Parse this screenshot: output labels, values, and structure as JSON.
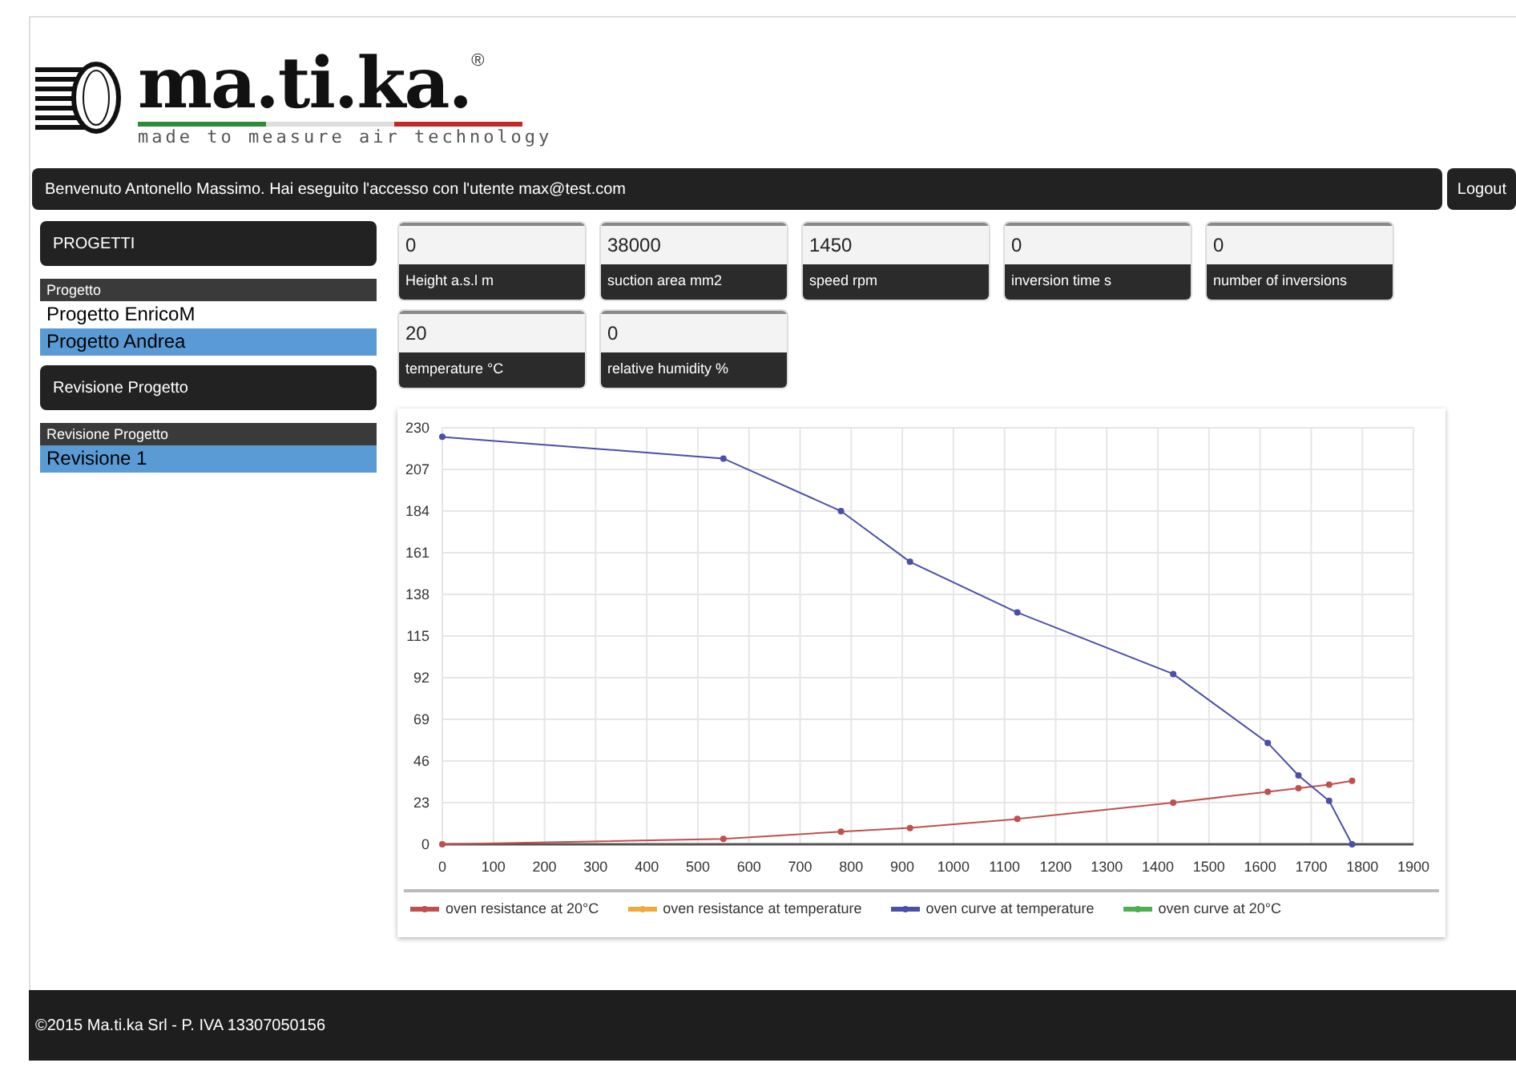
{
  "logo": {
    "name": "ma.ti.ka.",
    "registered": "®",
    "tagline": "made to measure air technology"
  },
  "welcome_bar": {
    "text": "Benvenuto Antonello Massimo. Hai eseguito l'accesso con l'utente max@test.com"
  },
  "logout_button": {
    "label": "Logout"
  },
  "sidebar": {
    "projects_header": "PROGETTI",
    "projects_list": {
      "header": "Progetto",
      "items": [
        {
          "label": "Progetto EnricoM",
          "selected": false
        },
        {
          "label": "Progetto Andrea",
          "selected": true
        }
      ]
    },
    "revision_header": "Revisione Progetto",
    "revision_list": {
      "header": "Revisione Progetto",
      "items": [
        {
          "label": "Revisione 1",
          "selected": true
        }
      ]
    }
  },
  "fields": [
    {
      "value": "0",
      "label": "Height a.s.l m"
    },
    {
      "value": "38000",
      "label": "suction area mm2"
    },
    {
      "value": "1450",
      "label": "speed rpm"
    },
    {
      "value": "0",
      "label": "inversion time s"
    },
    {
      "value": "0",
      "label": "number of inversions"
    },
    {
      "value": "20",
      "label": "temperature °C"
    },
    {
      "value": "0",
      "label": "relative humidity %"
    }
  ],
  "chart_data": {
    "type": "line",
    "x": [
      0,
      550,
      780,
      915,
      1125,
      1430,
      1615,
      1675,
      1735,
      1780
    ],
    "series": [
      {
        "name": "oven resistance at 20°C",
        "color": "#c0504d",
        "marker": "circle",
        "values": [
          0,
          3,
          7,
          9,
          14,
          23,
          29,
          31,
          33,
          35
        ]
      },
      {
        "name": "oven resistance at temperature",
        "color": "#f2a93b",
        "marker": "circle",
        "values": [
          null,
          null,
          null,
          null,
          null,
          null,
          null,
          null,
          null,
          null
        ]
      },
      {
        "name": "oven curve at temperature",
        "color": "#4a4fa8",
        "marker": "circle",
        "values": [
          225,
          213,
          184,
          156,
          128,
          94,
          56,
          38,
          24,
          0
        ]
      },
      {
        "name": "oven curve at 20°C",
        "color": "#4caf50",
        "marker": "circle",
        "values": [
          null,
          null,
          null,
          null,
          null,
          null,
          null,
          null,
          null,
          null
        ]
      }
    ],
    "grid": true,
    "legend": true,
    "xlim": [
      0,
      1900
    ],
    "ylim": [
      0,
      230
    ],
    "xticks": [
      0,
      100,
      200,
      300,
      400,
      500,
      600,
      700,
      800,
      900,
      1000,
      1100,
      1200,
      1300,
      1400,
      1500,
      1600,
      1700,
      1800,
      1900
    ],
    "yticks": [
      0,
      23,
      46,
      69,
      92,
      115,
      138,
      161,
      184,
      207,
      230
    ]
  },
  "footer": {
    "text": "©2015 Ma.ti.ka Srl - P. IVA 13307050156"
  }
}
